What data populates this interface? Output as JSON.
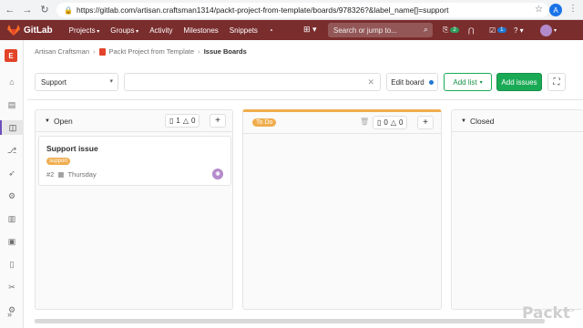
{
  "browser": {
    "url": "https://gitlab.com/artisan.craftsman1314/packt-project-from-template/boards/978326?&label_name[]=support",
    "avatar_letter": "A"
  },
  "header": {
    "app_name": "GitLab",
    "nav": [
      "Projects",
      "Groups",
      "Activity",
      "Milestones",
      "Snippets"
    ],
    "search_placeholder": "Search or jump to...",
    "mr_count": "2",
    "todo_count": "1"
  },
  "sidebar": {
    "project_letter": "E"
  },
  "breadcrumb": {
    "items": [
      "Artisan Craftsman",
      "Packt Project from Template",
      "Issue Boards"
    ]
  },
  "toolbar": {
    "board_name": "Support",
    "edit_board": "Edit board",
    "add_list": "Add list",
    "add_issues": "Add issues"
  },
  "lists": {
    "open": {
      "title": "Open",
      "issue_count": "1",
      "weight": "0"
    },
    "todo": {
      "title": "To Do",
      "issue_count": "0",
      "weight": "0",
      "color": "#f0ad4e"
    },
    "closed": {
      "title": "Closed"
    }
  },
  "card": {
    "title": "Support issue",
    "label": "support",
    "number": "#2",
    "due": "Thursday"
  },
  "watermark": "Packt",
  "colors": {
    "header": "#7a2d2d",
    "accent_green": "#1aaa55",
    "label_orange": "#f0ad4e"
  }
}
